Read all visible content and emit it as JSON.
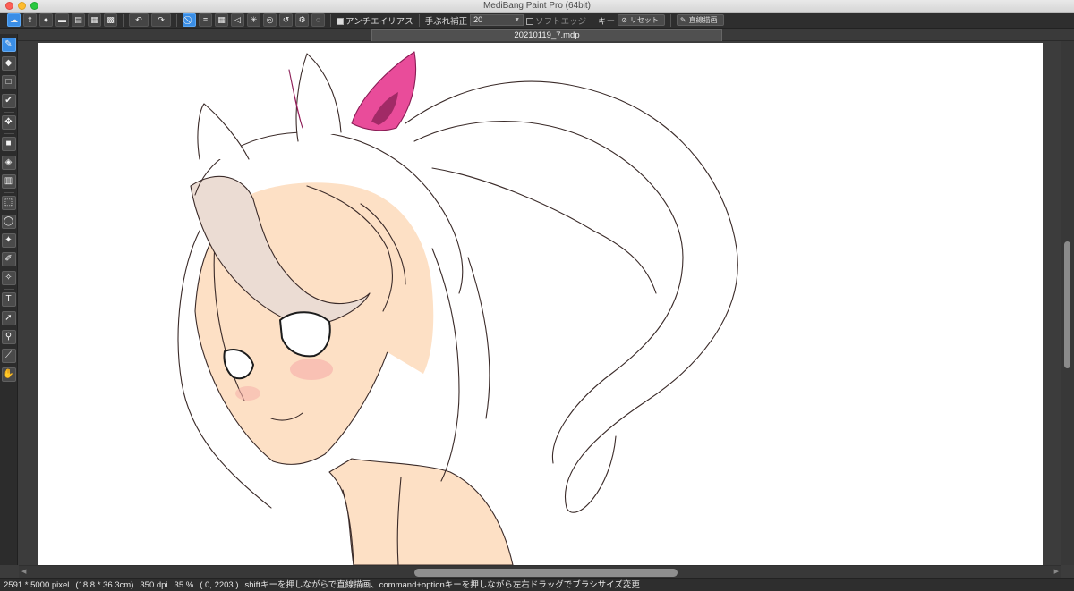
{
  "window": {
    "title": "MediBang Paint Pro (64bit)"
  },
  "toolbar": {
    "antialias_label": "アンチエイリアス",
    "stabilizer_label": "手ぶれ補正",
    "stabilizer_value": "20",
    "soft_edge_label": "ソフトエッジ",
    "key_label": "キー",
    "reset_label": "リセット",
    "straight_line_label": "直線描画"
  },
  "document": {
    "tab_title": "20210119_7.mdp"
  },
  "icons": {
    "cloud": "☁",
    "export": "⇪",
    "speech": "●",
    "comic": "▬",
    "page": "▤",
    "grid": "▦",
    "arrange": "▩",
    "undo": "↶",
    "redo": "↷",
    "snap_off": "⃠",
    "snap_parallel": "≡",
    "snap_grid": "▦",
    "snap_vanish": "◁",
    "snap_radial": "✳",
    "snap_circle": "◎",
    "snap_curve": "↺",
    "settings": "⚙",
    "snap_option": "◌",
    "no": "⊘",
    "pen": "✎"
  },
  "tools": [
    {
      "name": "brush-tool",
      "icon": "✎"
    },
    {
      "name": "eraser-tool",
      "icon": "◆"
    },
    {
      "name": "dot-tool",
      "icon": "□"
    },
    {
      "name": "select-pen-tool",
      "icon": "✔"
    },
    {
      "name": "move-tool",
      "icon": "✥"
    },
    {
      "name": "shape-fill-tool",
      "icon": "■"
    },
    {
      "name": "bucket-tool",
      "icon": "◈"
    },
    {
      "name": "gradient-tool",
      "icon": "▥"
    },
    {
      "name": "rect-select-tool",
      "icon": "⬚"
    },
    {
      "name": "lasso-tool",
      "icon": "◯"
    },
    {
      "name": "magic-wand-tool",
      "icon": "✦"
    },
    {
      "name": "select-pen-2-tool",
      "icon": "✐"
    },
    {
      "name": "select-eraser-tool",
      "icon": "✧"
    },
    {
      "name": "text-tool",
      "icon": "T"
    },
    {
      "name": "operation-tool",
      "icon": "➚"
    },
    {
      "name": "dropper-tool",
      "icon": "⚲"
    },
    {
      "name": "divide-tool",
      "icon": "⟋"
    },
    {
      "name": "hand-tool",
      "icon": "✋"
    }
  ],
  "status": {
    "size": "2591 * 5000 pixel",
    "size_cm": "(18.8 * 36.3cm)",
    "dpi": "350 dpi",
    "zoom": "35 %",
    "coords": "( 0, 2203 )",
    "hint": "shiftキーを押しながらで直線描画、command+optionキーを押しながら左右ドラッグでブラシサイズ変更"
  },
  "colors": {
    "accent": "#3a8ee6",
    "canvas": "#ffffff",
    "skin": "#fde0c5",
    "ribbon": "#e94c9a"
  }
}
